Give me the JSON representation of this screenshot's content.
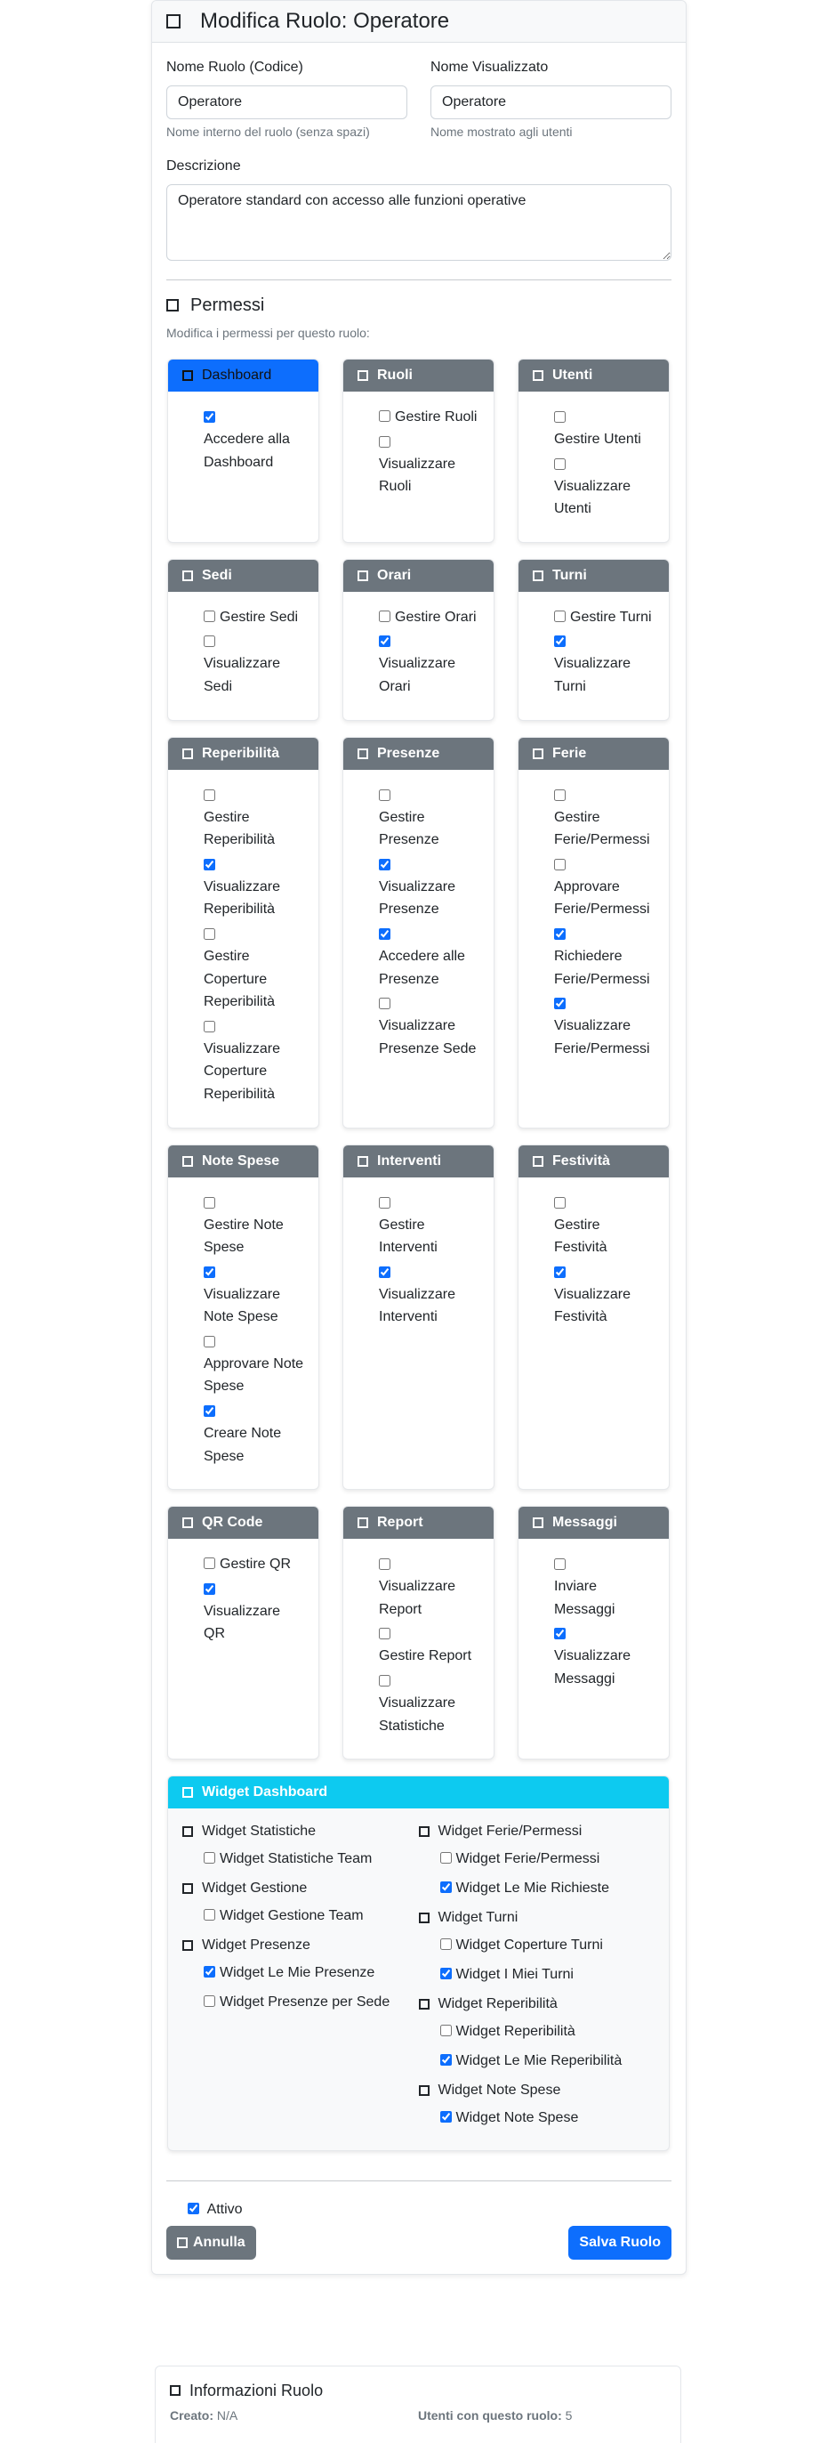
{
  "colors": {
    "primary": "#0d6efd",
    "secondary": "#6c757d",
    "info": "#0dcaf0"
  },
  "header": {
    "title": "Modifica Ruolo: Operatore",
    "icon": "square-icon"
  },
  "form": {
    "role_code": {
      "label": "Nome Ruolo (Codice)",
      "value": "Operatore",
      "help": "Nome interno del ruolo (senza spazi)"
    },
    "display_name": {
      "label": "Nome Visualizzato",
      "value": "Operatore",
      "help": "Nome mostrato agli utenti"
    },
    "description": {
      "label": "Descrizione",
      "value": "Operatore standard con accesso alle funzioni operative"
    }
  },
  "permissions": {
    "title": "Permessi",
    "subtitle": "Modifica i permessi per questo ruolo:",
    "groups": [
      {
        "title": "Dashboard",
        "variant": "primary",
        "items": [
          {
            "label": "Accedere alla Dashboard",
            "checked": true
          }
        ]
      },
      {
        "title": "Ruoli",
        "variant": "secondary",
        "items": [
          {
            "label": "Gestire Ruoli",
            "checked": false
          },
          {
            "label": "Visualizzare Ruoli",
            "checked": false
          }
        ]
      },
      {
        "title": "Utenti",
        "variant": "secondary",
        "items": [
          {
            "label": "Gestire Utenti",
            "checked": false
          },
          {
            "label": "Visualizzare Utenti",
            "checked": false
          }
        ]
      },
      {
        "title": "Sedi",
        "variant": "secondary",
        "items": [
          {
            "label": "Gestire Sedi",
            "checked": false
          },
          {
            "label": "Visualizzare Sedi",
            "checked": false
          }
        ]
      },
      {
        "title": "Orari",
        "variant": "secondary",
        "items": [
          {
            "label": "Gestire Orari",
            "checked": false
          },
          {
            "label": "Visualizzare Orari",
            "checked": true
          }
        ]
      },
      {
        "title": "Turni",
        "variant": "secondary",
        "items": [
          {
            "label": "Gestire Turni",
            "checked": false
          },
          {
            "label": "Visualizzare Turni",
            "checked": true
          }
        ]
      },
      {
        "title": "Reperibilità",
        "variant": "secondary",
        "items": [
          {
            "label": "Gestire Reperibilità",
            "checked": false
          },
          {
            "label": "Visualizzare Reperibilità",
            "checked": true
          },
          {
            "label": "Gestire Coperture Reperibilità",
            "checked": false
          },
          {
            "label": "Visualizzare Coperture Reperibilità",
            "checked": false
          }
        ]
      },
      {
        "title": "Presenze",
        "variant": "secondary",
        "items": [
          {
            "label": "Gestire Presenze",
            "checked": false
          },
          {
            "label": "Visualizzare Presenze",
            "checked": true
          },
          {
            "label": "Accedere alle Presenze",
            "checked": true
          },
          {
            "label": "Visualizzare Presenze Sede",
            "checked": false
          }
        ]
      },
      {
        "title": "Ferie",
        "variant": "secondary",
        "items": [
          {
            "label": "Gestire Ferie/Permessi",
            "checked": false
          },
          {
            "label": "Approvare Ferie/Permessi",
            "checked": false
          },
          {
            "label": "Richiedere Ferie/Permessi",
            "checked": true
          },
          {
            "label": "Visualizzare Ferie/Permessi",
            "checked": true
          }
        ]
      },
      {
        "title": "Note Spese",
        "variant": "secondary",
        "items": [
          {
            "label": "Gestire Note Spese",
            "checked": false
          },
          {
            "label": "Visualizzare Note Spese",
            "checked": true
          },
          {
            "label": "Approvare Note Spese",
            "checked": false
          },
          {
            "label": "Creare Note Spese",
            "checked": true
          }
        ]
      },
      {
        "title": "Interventi",
        "variant": "secondary",
        "items": [
          {
            "label": "Gestire Interventi",
            "checked": false
          },
          {
            "label": "Visualizzare Interventi",
            "checked": true
          }
        ]
      },
      {
        "title": "Festività",
        "variant": "secondary",
        "items": [
          {
            "label": "Gestire Festività",
            "checked": false
          },
          {
            "label": "Visualizzare Festività",
            "checked": true
          }
        ]
      },
      {
        "title": "QR Code",
        "variant": "secondary",
        "items": [
          {
            "label": "Gestire QR",
            "checked": false
          },
          {
            "label": "Visualizzare QR",
            "checked": true
          }
        ]
      },
      {
        "title": "Report",
        "variant": "secondary",
        "items": [
          {
            "label": "Visualizzare Report",
            "checked": false
          },
          {
            "label": "Gestire Report",
            "checked": false
          },
          {
            "label": "Visualizzare Statistiche",
            "checked": false
          }
        ]
      },
      {
        "title": "Messaggi",
        "variant": "secondary",
        "items": [
          {
            "label": "Inviare Messaggi",
            "checked": false
          },
          {
            "label": "Visualizzare Messaggi",
            "checked": true
          }
        ]
      }
    ]
  },
  "widgets": {
    "title": "Widget Dashboard",
    "variant": "info",
    "columns": [
      [
        {
          "title": "Widget Statistiche",
          "items": [
            {
              "label": "Widget Statistiche Team",
              "checked": false
            }
          ]
        },
        {
          "title": "Widget Gestione",
          "items": [
            {
              "label": "Widget Gestione Team",
              "checked": false
            }
          ]
        },
        {
          "title": "Widget Presenze",
          "items": [
            {
              "label": "Widget Le Mie Presenze",
              "checked": true
            },
            {
              "label": "Widget Presenze per Sede",
              "checked": false
            }
          ]
        }
      ],
      [
        {
          "title": "Widget Ferie/Permessi",
          "items": [
            {
              "label": "Widget Ferie/Permessi",
              "checked": false
            },
            {
              "label": "Widget Le Mie Richieste",
              "checked": true
            }
          ]
        },
        {
          "title": "Widget Turni",
          "items": [
            {
              "label": "Widget Coperture Turni",
              "checked": false
            },
            {
              "label": "Widget I Miei Turni",
              "checked": true
            }
          ]
        },
        {
          "title": "Widget Reperibilità",
          "items": [
            {
              "label": "Widget Reperibilità",
              "checked": false
            },
            {
              "label": "Widget Le Mie Reperibilità",
              "checked": true
            }
          ]
        },
        {
          "title": "Widget Note Spese",
          "items": [
            {
              "label": "Widget Note Spese",
              "checked": true
            }
          ]
        }
      ]
    ]
  },
  "active": {
    "label": "Attivo",
    "checked": true
  },
  "buttons": {
    "cancel": "Annulla",
    "save": "Salva Ruolo"
  },
  "info": {
    "title": "Informazioni Ruolo",
    "created_label": "Creato:",
    "created_value": "N/A",
    "users_label": "Utenti con questo ruolo:",
    "users_value": "5"
  }
}
